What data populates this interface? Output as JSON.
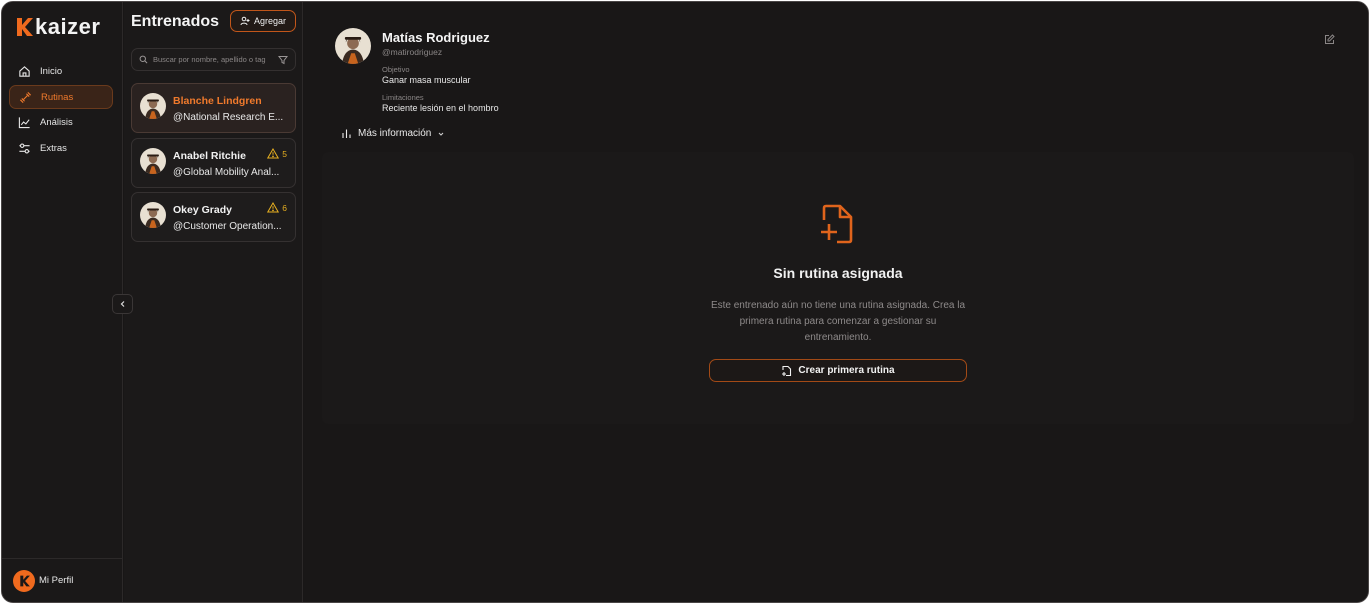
{
  "brand": {
    "name": "kaizer",
    "accent": "#f06a1e"
  },
  "nav": {
    "items": [
      {
        "label": "Inicio",
        "icon": "home-icon",
        "active": false
      },
      {
        "label": "Rutinas",
        "icon": "dumbbell-icon",
        "active": true
      },
      {
        "label": "Análisis",
        "icon": "chart-line-icon",
        "active": false
      },
      {
        "label": "Extras",
        "icon": "sliders-icon",
        "active": false
      }
    ],
    "profile_label": "Mi Perfil"
  },
  "trainees": {
    "title": "Entrenados",
    "add_label": "Agregar",
    "search_placeholder": "Buscar por nombre, apellido o tag",
    "items": [
      {
        "name": "Blanche Lindgren",
        "handle": "@National Research E...",
        "alert": "",
        "selected": true
      },
      {
        "name": "Anabel Ritchie",
        "handle": "@Global Mobility Anal...",
        "alert": "5",
        "selected": false
      },
      {
        "name": "Okey Grady",
        "handle": "@Customer Operation...",
        "alert": "6",
        "selected": false
      }
    ]
  },
  "profile": {
    "name": "Matías Rodriguez",
    "handle": "@matirodriguez",
    "objective_label": "Objetivo",
    "objective_value": "Ganar masa muscular",
    "limitations_label": "Limitaciones",
    "limitations_value": "Reciente lesión en el hombro",
    "more_info_label": "Más información"
  },
  "empty_state": {
    "title": "Sin rutina asignada",
    "description": "Este entrenado aún no tiene una rutina asignada. Crea la primera rutina para comenzar a gestionar su entrenamiento.",
    "button_label": "Crear primera rutina"
  }
}
